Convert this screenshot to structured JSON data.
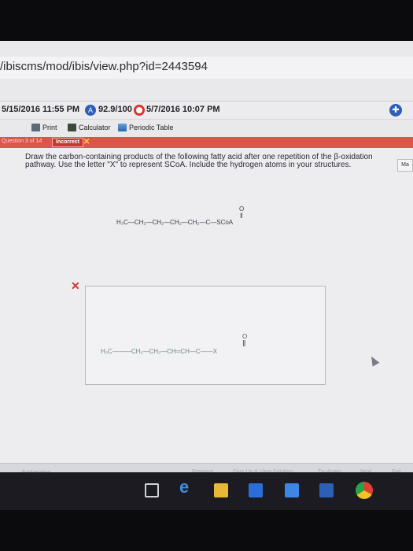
{
  "browser": {
    "url": "/ibiscms/mod/ibis/view.php?id=2443594"
  },
  "status": {
    "start_time": "5/15/2016 11:55 PM",
    "score": "92.9/100",
    "due_time": "5/7/2016 10:07 PM"
  },
  "toolbar": {
    "print": "Print",
    "calculator": "Calculator",
    "periodic": "Periodic Table"
  },
  "question": {
    "number_label": "Question 3 of 14",
    "result": "Incorrect",
    "text": "Draw the carbon-containing products of the following fatty acid after one repetition of the β-oxidation pathway. Use the letter \"X\" to represent SCoA. Include the hydrogen atoms in your structures.",
    "given_carbonyl_o": "O",
    "given_structure": "H₃C—CH₂—CH₂—CH₂—CH₂—C—SCoA",
    "answer_carbonyl_o": "O",
    "answer_structure": "H₃C———CH₂—CH₂—CH═CH—C——X",
    "side_tab": "Ma"
  },
  "footer": {
    "explanation": "Explanation",
    "previous": "Previous",
    "give_up": "Give Up & View Solution",
    "try_again": "Try Again",
    "next": "Next",
    "exit": "Exit"
  },
  "desktop": {
    "label": "indows"
  }
}
